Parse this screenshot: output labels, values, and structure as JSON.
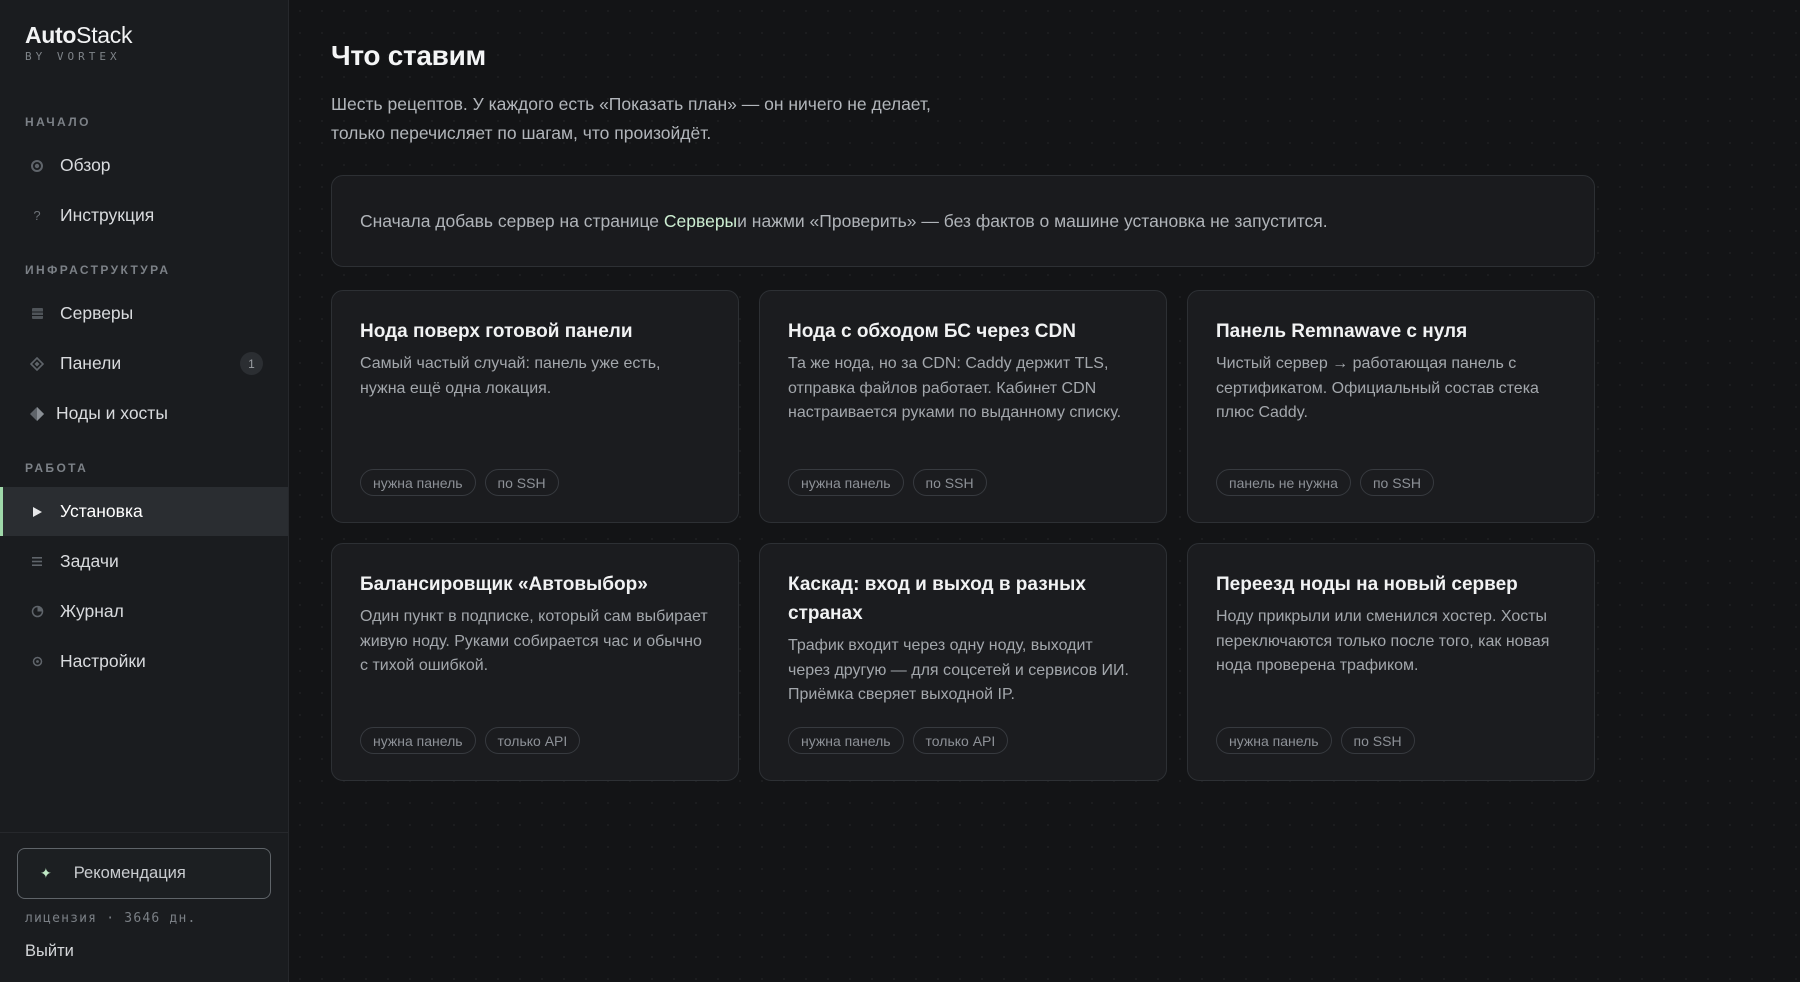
{
  "brand": {
    "name_bold": "Auto",
    "name_rest": "Stack",
    "sub": "BY VORTEX"
  },
  "sidebar": {
    "sections": [
      {
        "label": "НАЧАЛО"
      },
      {
        "label": "ИНФРАСТРУКТУРА"
      },
      {
        "label": "РАБОТА"
      }
    ],
    "items": [
      {
        "label": "Обзор",
        "icon": "circle-icon"
      },
      {
        "label": "Инструкция",
        "icon": "question-icon"
      },
      {
        "label": "Серверы",
        "icon": "server-icon"
      },
      {
        "label": "Панели",
        "icon": "diamond-icon",
        "badge": "1"
      },
      {
        "label": "Ноды и хосты",
        "icon": "diamond-split-icon"
      },
      {
        "label": "Установка",
        "icon": "play-icon",
        "active": true
      },
      {
        "label": "Задачи",
        "icon": "list-icon"
      },
      {
        "label": "Журнал",
        "icon": "clock-icon"
      },
      {
        "label": "Настройки",
        "icon": "gear-icon"
      }
    ],
    "recommend_label": "Рекомендация",
    "license": "лицензия · 3646 дн.",
    "logout": "Выйти"
  },
  "main": {
    "title": "Что ставим",
    "desc_line1": "Шесть рецептов. У каждого есть «Показать план» — он ничего не делает,",
    "desc_line2": "только перечисляет по шагам, что произойдёт.",
    "notice": {
      "before": "Сначала добавь сервер на странице ",
      "link": "Серверы",
      "after": " и нажми «Проверить» — без фактов о машине установка не запустится."
    },
    "cards": [
      {
        "title": "Нода поверх готовой панели",
        "desc": "Самый частый случай: панель уже есть, нужна ещё одна локация.",
        "tags": [
          "нужна панель",
          "по SSH"
        ]
      },
      {
        "title": "Нода с обходом БС через CDN",
        "desc": "Та же нода, но за CDN: Caddy держит TLS, отправка файлов работает. Кабинет CDN настраивается руками по выданному списку.",
        "tags": [
          "нужна панель",
          "по SSH"
        ]
      },
      {
        "title": "Панель Remnawave с нуля",
        "desc": "Чистый сервер → работающая панель с сертификатом. Официальный состав стека плюс Caddy.",
        "tags": [
          "панель не нужна",
          "по SSH"
        ]
      },
      {
        "title": "Балансировщик «Автовыбор»",
        "desc": "Один пункт в подписке, который сам выбирает живую ноду. Руками собирается час и обычно с тихой ошибкой.",
        "tags": [
          "нужна панель",
          "только API"
        ]
      },
      {
        "title": "Каскад: вход и выход в разных странах",
        "desc": "Трафик входит через одну ноду, выходит через другую — для соцсетей и сервисов ИИ. Приёмка сверяет выходной IP.",
        "tags": [
          "нужна панель",
          "только API"
        ]
      },
      {
        "title": "Переезд ноды на новый сервер",
        "desc": "Ноду прикрыли или сменился хостер. Хосты переключаются только после того, как новая нода проверена трафиком.",
        "tags": [
          "нужна панель",
          "по SSH"
        ]
      }
    ]
  },
  "colors": {
    "accent": "#9fd8a9",
    "link": "#cdeed2",
    "bg": "#131416",
    "sidebar": "#1a1c1f"
  }
}
